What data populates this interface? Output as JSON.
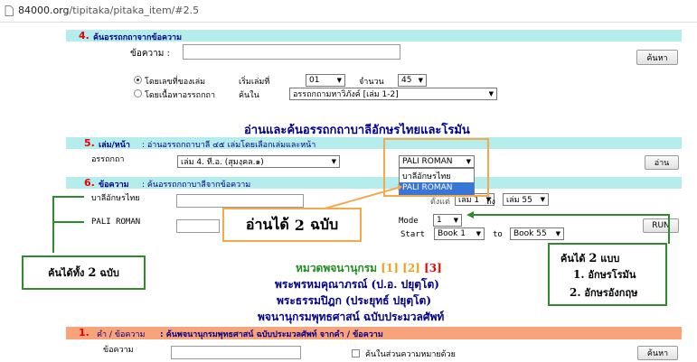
{
  "browser": {
    "url_domain": "84000.org",
    "url_path": "/tipitaka/pitaka_item/#2.5"
  },
  "section4": {
    "num": "4.",
    "title": "ค้นอรรถกถาจากข้อความ",
    "text_label": "ข้อความ :",
    "search_button": "ค้นหา",
    "radio_by_volume": "โดยเลขที่ของเล่ม",
    "radio_by_content": "โดยเนื้อหาอรรถกถา",
    "start_volume_label": "เริ่มเล่มที่",
    "start_volume_value": "01",
    "amount_label": "จำนวน",
    "amount_value": "45",
    "search_in_label": "ค้นใน",
    "search_in_value": "อรรถกถามหาวิภังค์ [เล่ม 1-2]"
  },
  "heading_read_search": "อ่านและค้นอรรถกถาบาลีอักษรไทยและโรมัน",
  "section5": {
    "num": "5.",
    "title": "เล่ม/หน้า",
    "desc": ": อ่านอรรถกถาบาลี ๔๕ เล่มโดยเลือกเล่มและหน้า",
    "label": "อรรถกถา",
    "volume_value": "เล่ม 4. ที.อ. (สุมงฺคล.๑)",
    "script_value": "PALI ROMAN",
    "dropdown_options": [
      "บาลีอักษรไทย",
      "PALI ROMAN"
    ],
    "read_button": "อ่าน"
  },
  "section6": {
    "num": "6.",
    "title": "ข้อความ",
    "desc": ": ค้นอรรถกถาบาลีจากข้อความ",
    "pali_thai_label": "บาลีอักษรไทย",
    "pali_roman_label": "PALI ROMAN",
    "hidden_prefix": "ตั้งแต่",
    "hidden_vol_value": "เล่ม 1",
    "hidden_to": "ถึง",
    "end_vol_value": "เล่ม 55",
    "mode_label": "Mode",
    "mode_value": "1",
    "start_label": "Start",
    "start_value": "Book 1",
    "to_label": "to",
    "end_value": "Book 55",
    "run_button": "RUN"
  },
  "dictionary": {
    "title": "หมวดพจนานุกรม",
    "pages": [
      "[1]",
      "[2]",
      "[3]"
    ],
    "line1": "พระพรหมคุณาภรณ์ (ป.อ. ปยุตฺโต)",
    "line2": "พระธรรมปิฎก (ประยุทธ์ ปยุตฺโต)",
    "line3": "พจนานุกรมพุทธศาสน์ ฉบับประมวลศัพท์"
  },
  "section1": {
    "num": "1.",
    "title": "คำ / ข้อความ",
    "desc": ": ค้นพจนานุกรมพุทธศาสน์ ฉบับประมวลศัพท์ จากคำ / ข้อความ",
    "label": "ข้อความ",
    "checkbox_label": "ค้นในส่วนความหมายด้วย",
    "search_button": "ค้นหา"
  },
  "callouts": {
    "read_both_prefix": "อ่านได้",
    "read_both_num": "2",
    "read_both_suffix": "ฉบับ",
    "search_both_prefix": "ค้นได้ทั้ง",
    "search_both_num": "2",
    "search_both_suffix": "ฉบับ",
    "search_two_title_prefix": "ค้นได้",
    "search_two_title_num": "2",
    "search_two_title_suffix": "แบบ",
    "item1_num": "1.",
    "item1_text": "อักษรโรมัน",
    "item2_num": "2.",
    "item2_text": "อักษรอังกฤษ"
  },
  "colors": {
    "bar_cyan": "#b5ecec",
    "bar_orange": "#f8a37a",
    "callout_orange": "#f5a94a",
    "callout_green": "#2e8b2e",
    "title_navy": "#00008b"
  }
}
